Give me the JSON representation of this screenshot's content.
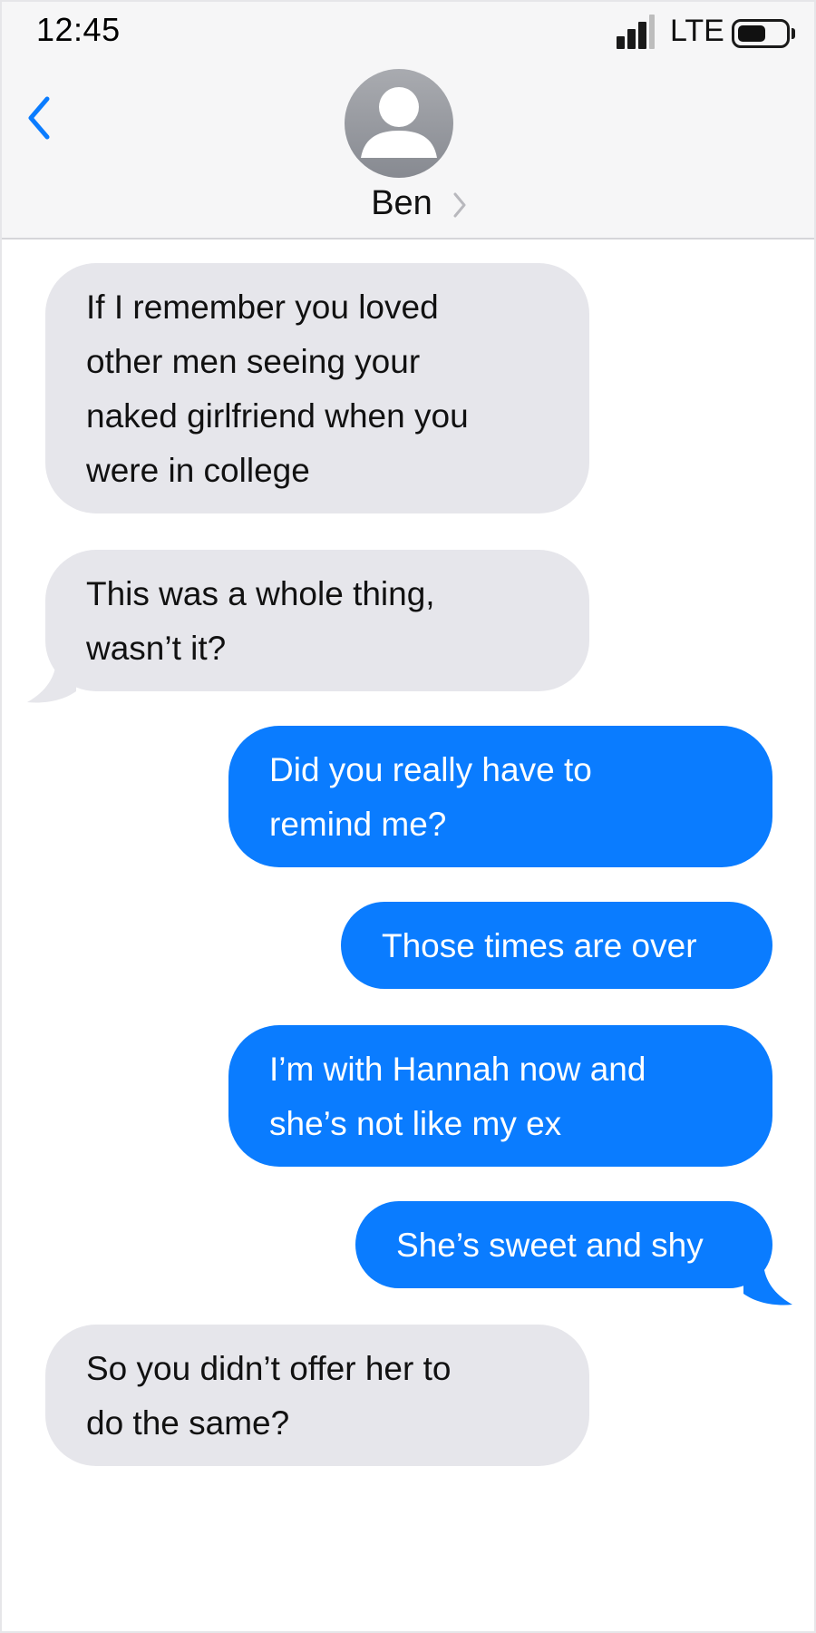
{
  "status_bar": {
    "time": "12:45",
    "network": "LTE",
    "signal_bars": 3,
    "signal_max": 4,
    "battery_level": 0.6
  },
  "header": {
    "back_icon": "chevron-left-icon",
    "contact_name": "Ben",
    "avatar_icon": "person-silhouette-icon",
    "detail_icon": "chevron-right-icon"
  },
  "colors": {
    "incoming_bubble": "#e6e6eb",
    "outgoing_bubble": "#0a7cff",
    "accent": "#0a7cff"
  },
  "messages": [
    {
      "direction": "incoming",
      "lines": [
        "If I remember you loved",
        "other men seeing your",
        "naked girlfriend when you",
        "were in college"
      ]
    },
    {
      "direction": "incoming",
      "lines": [
        "This was a whole thing,",
        "wasn’t it?"
      ]
    },
    {
      "direction": "outgoing",
      "lines": [
        "Did you really have to",
        "remind me?"
      ]
    },
    {
      "direction": "outgoing",
      "lines": [
        "Those times are over"
      ]
    },
    {
      "direction": "outgoing",
      "lines": [
        "I’m with Hannah now and",
        "she’s not like my ex"
      ]
    },
    {
      "direction": "outgoing",
      "lines": [
        "She’s sweet and shy"
      ]
    },
    {
      "direction": "incoming",
      "lines": [
        "So you didn’t offer her to",
        "do the same?"
      ]
    }
  ]
}
